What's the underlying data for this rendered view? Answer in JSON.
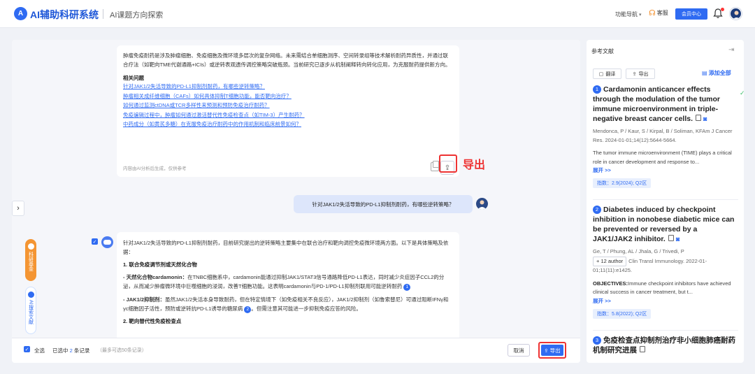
{
  "header": {
    "logo_glyph": "A",
    "brand": "AI辅助科研系统",
    "subtitle": "AI课题方向探索",
    "nav_menu": "功能导航",
    "kefu": "客服",
    "member_btn": "会员中心"
  },
  "card1": {
    "paragraph": "肿瘤免疫耐药是涉及肿瘤细胞、免疫细胞及微环境多层次的复杂网络。未来需结合单细胞测序、空间转录组等技术解析耐药异质性，并通过联合疗法（如靶向TME代谢通路+ICIs）或逆转表观遗传调控策略突破瓶颈。当前研究已逐步从机制阐释转向转化应用，为克服耐药提供新方向。",
    "related_title": "相关问题",
    "related": [
      "针对JAK1/2失活导致的PD-L1抑制剂耐药，有哪些逆转策略？",
      "肿瘤相关成纤维细胞（CAFs）如何具体抑制T细胞功能，能否靶向治疗？",
      "如何通过监测ctDNA或TCR多样性来预测和预防免疫治疗耐药？",
      "免疫编辑过程中，肿瘤如何通过激活替代性免疫检查点（如TIM-3）产生耐药？",
      "中药成分（如黄芪多糖）在克服免疫治疗耐药中的作用机制和临床前景如何？"
    ],
    "footer": "内容由AI分析后生成，仅供参考",
    "export_annotation": "导出"
  },
  "question": "针对JAK1/2失活导致的PD-L1抑制剂耐药，有哪些逆转策略？",
  "card2": {
    "intro": "针对JAK1/2失活导致的PD-L1抑制剂耐药，目前研究提出的逆转策略主要集中在联合治疗和靶向调控免疫微环境两方面。以下是具体策略及依据：",
    "section1": "1. 联合免疫调节剂或天然化合物",
    "item1_label": "- 天然化合物cardamonin：",
    "item1_text": "在TNBC细胞系中，cardamonin能通过抑制JAK1/STAT3信号通路降低PD-L1表达，同时减少炎症因子CCL2的分泌，从而减少肿瘤微环境中巨噬细胞的浸润，改善T细胞功能。这表明cardamonin与PD-1/PD-L1抑制剂联用可能逆转耐药",
    "item1_cite": "1",
    "item2_label": "- JAK1/2抑制剂：",
    "item2_text": "虽然JAK1/2失活本身导致耐药，但在特定情境下（如免疫相关不良反应），JAK1/2抑制剂（如鲁索替尼）可通过阻断IFNγ和γc细胞因子活性，预防或逆转抗PD-L1诱导的糖尿病",
    "item2_cite": "2",
    "item2_tail": "。但需注意其可能进一步抑制免疫应答的风险。",
    "section2": "2. 靶向替代性免疫检查点"
  },
  "side_tabs": {
    "fund": "科研基金",
    "search": "AI搜索文献"
  },
  "bottom_bar": {
    "select_all": "全选",
    "selected_prefix": "已选中",
    "selected_count": "2",
    "selected_suffix": "条记录",
    "limit": "（最多可选50条记录）",
    "cancel": "取消",
    "export": "导出"
  },
  "references": {
    "title": "参考文献",
    "translate": "翻译",
    "export": "导出",
    "add_all": "添加全部",
    "items": [
      {
        "num": "1",
        "title": "Cardamonin anticancer effects through the modulation of the tumor immune microenvironment in triple-negative breast cancer cells.",
        "authors": "Mendonca, P / Kaur, S / Kirpal, B / Soliman, KFAm J Cancer Res. 2024-01-01;14(12):5644-5664.",
        "abstract": "The tumor immune microenvironment (TIME) plays a critical role in cancer development and response to...",
        "more": "展开 >>",
        "badge": "指数：2.9(2024); Q2区"
      },
      {
        "num": "2",
        "title": "Diabetes induced by checkpoint inhibition in nonobese diabetic mice can be prevented or reversed by a JAK1/JAK2 inhibitor.",
        "authors": "Ge, T / Phung, AL / Jhala, G / Trivedi, P",
        "author_more": "+ 12 author",
        "journal": "Clin Transl Immunology. 2022-01-01;11(11):e1425.",
        "abstract_label": "OBJECTIVES:",
        "abstract": "Immune checkpoint inhibitors have achieved clinical success in cancer treatment, but t...",
        "more": "展开 >>",
        "badge": "指数：5.8(2022); Q2区"
      },
      {
        "num": "3",
        "title": "免疫检查点抑制剂治疗非小细胞肺癌耐药机制研究进展"
      }
    ]
  },
  "colors": {
    "accent": "#2f6bf2",
    "highlight": "#e33333",
    "fund_tab": "#f49533"
  }
}
